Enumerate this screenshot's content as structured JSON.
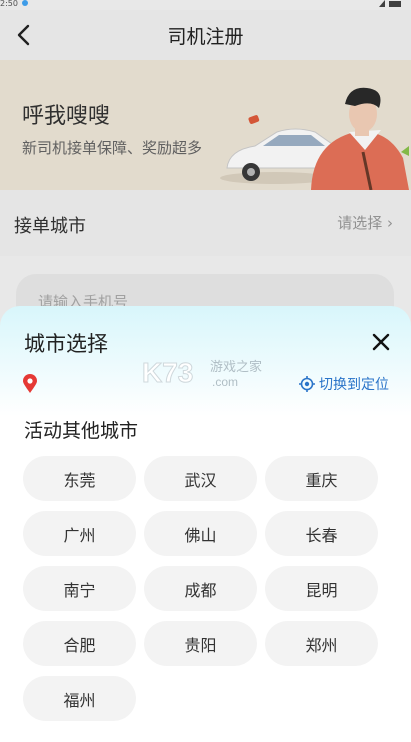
{
  "status_bar": {
    "time": "2:50"
  },
  "nav": {
    "title": "司机注册"
  },
  "banner": {
    "title": "呼我嗖嗖",
    "subtitle": "新司机接单保障、奖励超多"
  },
  "form": {
    "city_label": "接单城市",
    "city_value": "请选择 ›",
    "phone_placeholder": "请输入手机号"
  },
  "sheet": {
    "title": "城市选择",
    "watermark": "K73 游戏之家 .com",
    "locate_label": "切换到定位",
    "section_title": "活动其他城市",
    "cities": [
      "东莞",
      "武汉",
      "重庆",
      "广州",
      "佛山",
      "长春",
      "南宁",
      "成都",
      "昆明",
      "合肥",
      "贵阳",
      "郑州",
      "福州"
    ]
  },
  "colors": {
    "accent": "#2a74c9",
    "pin": "#e53935",
    "chip_bg": "#f3f3f3",
    "sheet_top": "#d8f6fb"
  }
}
